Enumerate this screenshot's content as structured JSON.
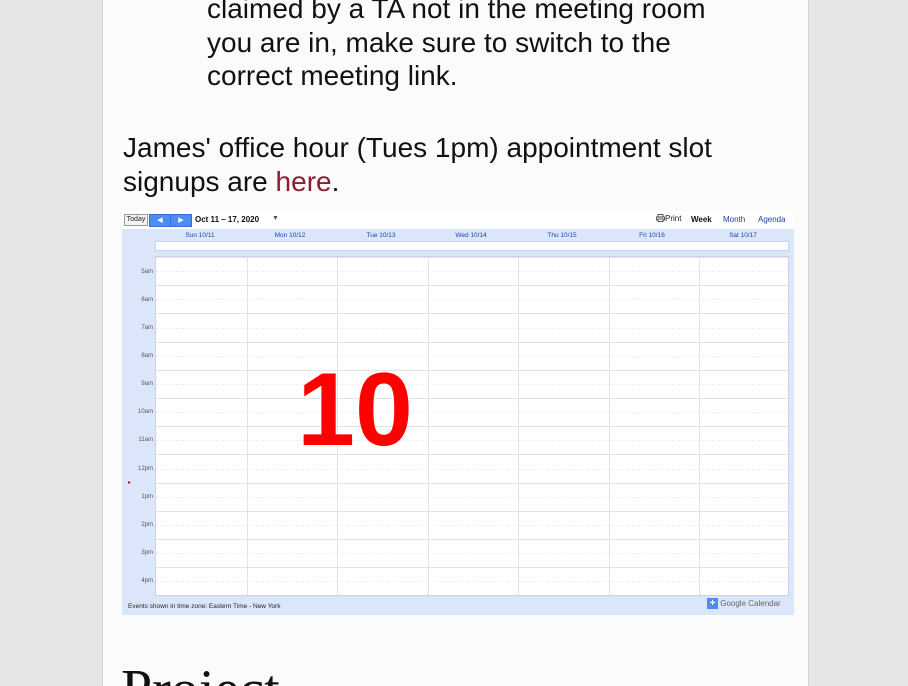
{
  "doc": {
    "indented_lines": [
      "claimed by a TA not in the meeting room",
      "you are in, make sure to switch to the",
      "correct meeting link."
    ],
    "paragraph_before": "James' office hour (Tues 1pm) appointment slot signups are ",
    "paragraph_link": "here",
    "paragraph_after": ".",
    "heading_partial": "Project"
  },
  "calendar": {
    "today_label": "Today",
    "prev_icon": "◀",
    "next_icon": "▶",
    "date_range": "Oct 11 – 17, 2020",
    "dropdown_icon": "▼",
    "print_label": "Print",
    "views": [
      "Week",
      "Month",
      "Agenda"
    ],
    "days": [
      "Sun 10/11",
      "Mon 10/12",
      "Tue 10/13",
      "Wed 10/14",
      "Thu 10/15",
      "Fri 10/16",
      "Sat 10/17"
    ],
    "hours": [
      "5am",
      "6am",
      "7am",
      "8am",
      "9am",
      "10am",
      "11am",
      "12pm",
      "1pm",
      "2pm",
      "3pm",
      "4pm"
    ],
    "now_marker": "▸",
    "footer": "Events shown in time zone: Eastern Time - New York",
    "badge_plus": "+",
    "badge_text": "Google Calendar"
  },
  "overlay": {
    "number": "10",
    "color": "#ff0000"
  }
}
